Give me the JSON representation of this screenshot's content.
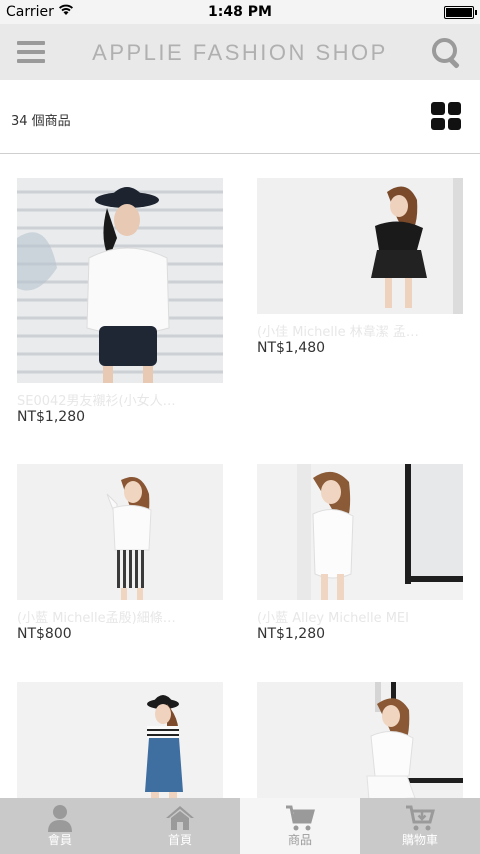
{
  "status_bar": {
    "carrier": "Carrier",
    "time": "1:48 PM"
  },
  "header": {
    "title": "APPLIE FASHION SHOP"
  },
  "toolbar": {
    "product_count": "34 個商品"
  },
  "products": [
    {
      "name": "SE0042男友襯衫(小女人…",
      "price": "NT$1,280"
    },
    {
      "name": "(小佳 Michelle 林韋潔 孟…",
      "price": "NT$1,480"
    },
    {
      "name": "(小藍 Michelle孟殷)細條…",
      "price": "NT$800"
    },
    {
      "name": "(小藍 Alley Michelle MEI",
      "price": "NT$1,280"
    },
    {
      "name": "",
      "price": ""
    },
    {
      "name": "",
      "price": ""
    }
  ],
  "tabs": [
    {
      "label": "會員",
      "icon": "member-icon"
    },
    {
      "label": "首頁",
      "icon": "home-icon"
    },
    {
      "label": "商品",
      "icon": "products-cart-icon",
      "active": true
    },
    {
      "label": "購物車",
      "icon": "shopping-cart-icon"
    }
  ],
  "colors": {
    "nav_bg": "#e9e9e9",
    "tab_bar_bg": "#c9c9c9",
    "active_tab_bg": "#f5f5f5",
    "title_gray": "#b0b0b0"
  }
}
